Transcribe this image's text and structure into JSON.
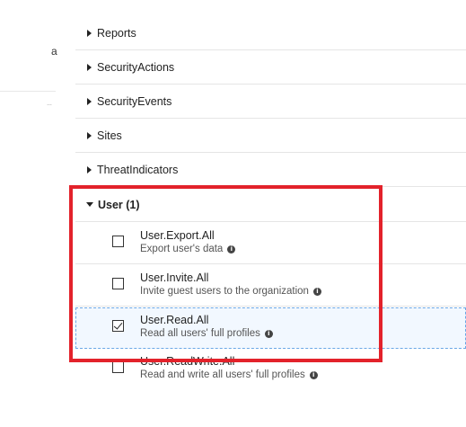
{
  "left": {
    "truncated_text": "a",
    "truncated_small": "…"
  },
  "groups": [
    {
      "label": "Reports"
    },
    {
      "label": "SecurityActions"
    },
    {
      "label": "SecurityEvents"
    },
    {
      "label": "Sites"
    },
    {
      "label": "ThreatIndicators"
    }
  ],
  "user_group": {
    "label": "User (1)"
  },
  "permissions": [
    {
      "name": "User.Export.All",
      "desc": "Export user's data",
      "checked": false
    },
    {
      "name": "User.Invite.All",
      "desc": "Invite guest users to the organization",
      "checked": false
    },
    {
      "name": "User.Read.All",
      "desc": "Read all users' full profiles",
      "checked": true
    },
    {
      "name": "User.ReadWrite.All",
      "desc": "Read and write all users' full profiles",
      "checked": false
    }
  ],
  "info_glyph": "i",
  "colors": {
    "highlight_border": "#e3222b",
    "selected_row_bg": "#f2f8ff",
    "selected_row_border": "#6aa7e6"
  }
}
